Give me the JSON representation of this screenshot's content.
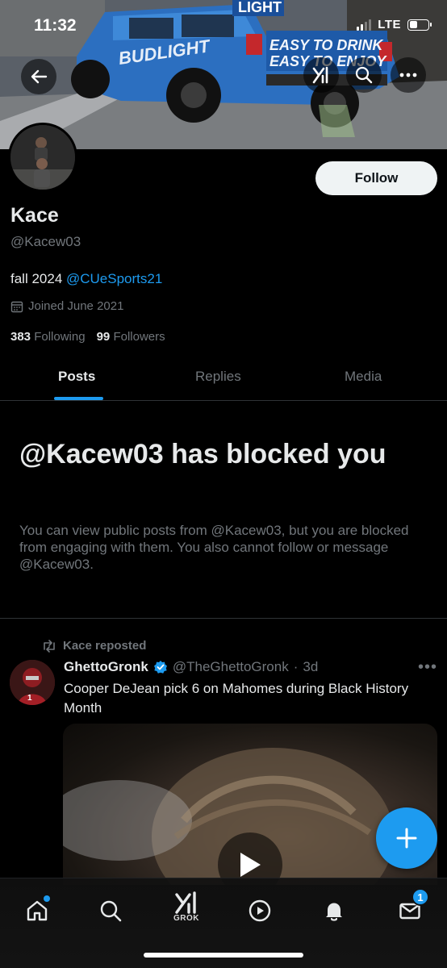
{
  "status_bar": {
    "time": "11:32",
    "network": "LTE"
  },
  "banner": {
    "truck_sign_text": "LIGHT",
    "truck_side_text": "BUDLIGHT",
    "truck_slogan_line1": "EASY TO DRINK",
    "truck_slogan_line2": "EASY TO ENJOY"
  },
  "profile": {
    "name": "Kace",
    "handle": "@Kacew03",
    "bio_text": "fall 2024 ",
    "bio_mention": "@CUeSports21",
    "joined": "Joined June 2021",
    "following_count": "383",
    "following_label": "Following",
    "followers_count": "99",
    "followers_label": "Followers",
    "follow_button": "Follow"
  },
  "tabs": [
    {
      "label": "Posts",
      "active": true
    },
    {
      "label": "Replies",
      "active": false
    },
    {
      "label": "Media",
      "active": false
    }
  ],
  "blocked": {
    "title": "@Kacew03 has blocked you",
    "message": "You can view public posts from @Kacew03, but you are blocked from engaging with them. You also cannot follow or message @Kacew03."
  },
  "post": {
    "repost_label": "Kace reposted",
    "author_name": "GhettoGronk",
    "author_handle": "@TheGhettoGronk",
    "time": "3d",
    "text": "Cooper DeJean pick 6 on Mahomes during Black History Month"
  },
  "bottom_nav": {
    "grok_label": "GROK",
    "messages_badge": "1"
  },
  "colors": {
    "accent": "#1d9bf0",
    "background": "#000000",
    "muted": "#71767b"
  }
}
